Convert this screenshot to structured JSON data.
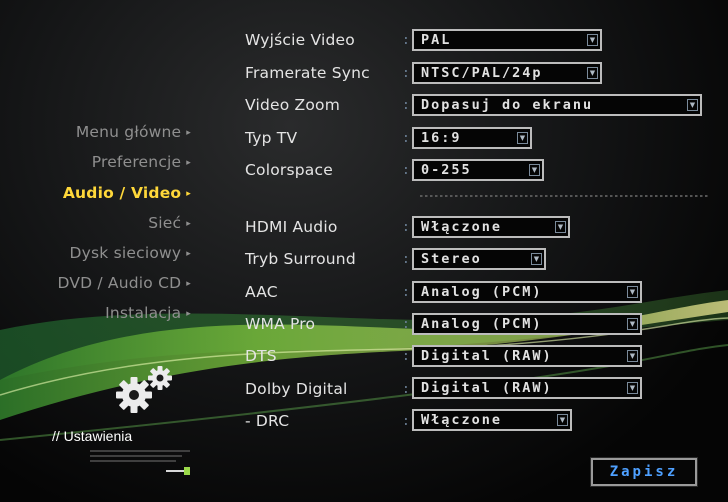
{
  "sidebar": {
    "items": [
      {
        "label": "Menu główne"
      },
      {
        "label": "Preferencje"
      },
      {
        "label": "Audio / Video"
      },
      {
        "label": "Sieć"
      },
      {
        "label": "Dysk sieciowy"
      },
      {
        "label": "DVD / Audio CD"
      },
      {
        "label": "Instalacja"
      }
    ],
    "active": "Audio / Video",
    "arrow_glyph": "▸",
    "section_title": "// Ustawienia",
    "section_icon": "gears-icon"
  },
  "settings": [
    {
      "label": "Wyjście Video",
      "value": "PAL"
    },
    {
      "label": "Framerate Sync",
      "value": "NTSC/PAL/24p"
    },
    {
      "label": "Video Zoom",
      "value": "Dopasuj do ekranu"
    },
    {
      "label": "Typ TV",
      "value": "16:9"
    },
    {
      "label": "Colorspace",
      "value": "0-255"
    },
    {
      "label": "HDMI Audio",
      "value": "Włączone"
    },
    {
      "label": "Tryb Surround",
      "value": "Stereo"
    },
    {
      "label": "AAC",
      "value": "Analog (PCM)"
    },
    {
      "label": "WMA Pro",
      "value": "Analog (PCM)"
    },
    {
      "label": "DTS",
      "value": "Digital (RAW)"
    },
    {
      "label": "Dolby Digital",
      "value": "Digital (RAW)"
    },
    {
      "label": "- DRC",
      "value": "Włączone"
    }
  ],
  "colon": ":",
  "save_label": "Zapisz",
  "colors": {
    "active_nav": "#ffd83a",
    "save_text": "#4ea0ff",
    "accent_swoosh": "#7abd3c"
  }
}
